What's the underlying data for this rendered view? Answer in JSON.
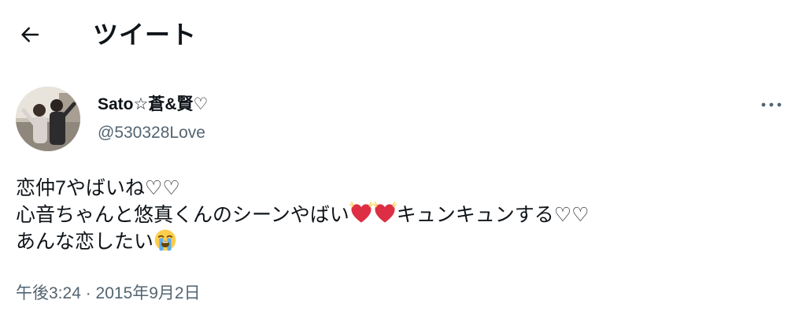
{
  "header": {
    "back_icon": "arrow-left-icon",
    "title": "ツイート"
  },
  "tweet": {
    "author": {
      "display_name": "Sato☆蒼&賢♡",
      "handle": "@530328Love"
    },
    "more_icon": "more-horizontal-icon",
    "lines": [
      {
        "text_a": "恋仲7やばいね♡♡"
      },
      {
        "text_a": "心音ちゃんと悠真くんのシーンやばい",
        "emoji": [
          "beating-heart-icon",
          "beating-heart-icon"
        ],
        "text_b": "キュンキュンする♡♡"
      },
      {
        "text_a": "あんな恋したい",
        "emoji": [
          "loudly-crying-face-icon"
        ]
      }
    ],
    "timestamp": "午後3:24 · 2015年9月2日"
  },
  "colors": {
    "text_primary": "#0f1419",
    "text_secondary": "#536471",
    "heart_red": "#dd2e44",
    "emoji_yellow": "#ffcc4d"
  }
}
